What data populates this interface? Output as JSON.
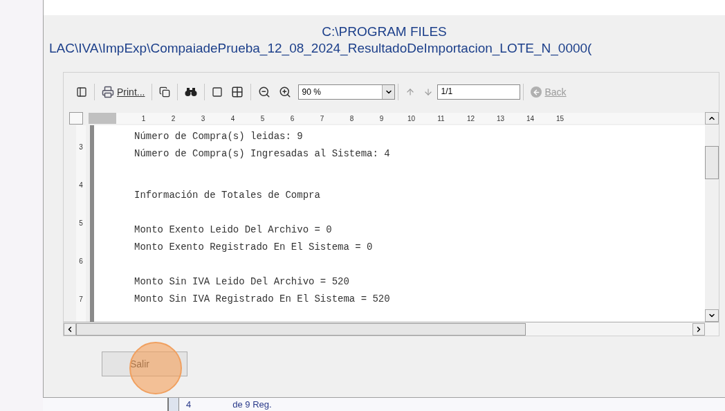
{
  "header": {
    "path_line_1": "C:\\PROGRAM FILES",
    "path_line_2": "LAC\\IVA\\ImpExp\\CompaiadePrueba_12_08_2024_ResultadoDeImportacion_LOTE_N_0000("
  },
  "toolbar": {
    "print": "Print...",
    "zoom": "90 %",
    "page": "1/1",
    "back": {
      "label": "Back",
      "disabled": true
    }
  },
  "ruler": {
    "marks": [
      "1",
      "2",
      "3",
      "4",
      "5",
      "6",
      "7",
      "8",
      "9",
      "10",
      "11",
      "12",
      "13",
      "14",
      "15"
    ],
    "side_marks": [
      "3",
      "4",
      "5",
      "6",
      "7"
    ]
  },
  "report": {
    "groups": [
      [
        "Número de Compra(s) leidas: 9",
        "Número de Compra(s) Ingresadas al Sistema: 4"
      ],
      [
        "Información de Totales de Compra"
      ],
      [
        "Monto Exento Leido Del Archivo = 0",
        "Monto Exento Registrado En El Sistema = 0"
      ],
      [
        "Monto Sin IVA Leido Del Archivo = 520",
        "Monto Sin IVA Registrado En El Sistema = 520"
      ]
    ]
  },
  "exit_button": "Salir",
  "behind": {
    "count": "4",
    "records": "de 9 Reg."
  }
}
